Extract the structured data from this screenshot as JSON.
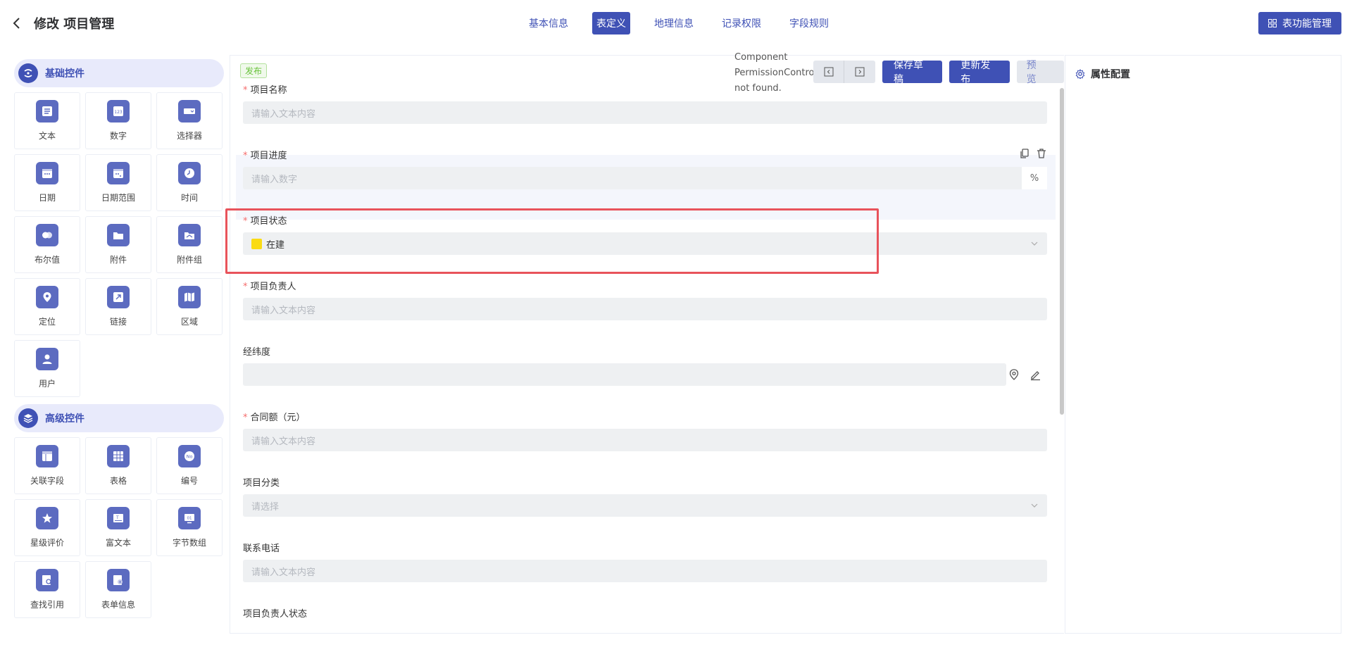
{
  "header": {
    "title": "修改 项目管理",
    "tabs": [
      "基本信息",
      "表定义",
      "地理信息",
      "记录权限",
      "字段规则"
    ],
    "active_tab": "表定义",
    "func_button": "表功能管理"
  },
  "sidebar": {
    "basic_group": "基础控件",
    "basic_items": [
      "文本",
      "数字",
      "选择器",
      "日期",
      "日期范围",
      "时间",
      "布尔值",
      "附件",
      "附件组",
      "定位",
      "链接",
      "区域",
      "用户"
    ],
    "advanced_group": "高级控件",
    "advanced_items": [
      "关联字段",
      "表格",
      "编号",
      "星级评价",
      "富文本",
      "字节数组",
      "查找引用",
      "表单信息"
    ]
  },
  "form": {
    "publish_tag": "发布",
    "error_message": "Component PermissionControl not found.",
    "save_draft": "保存草稿",
    "update_publish": "更新发布",
    "preview": "预 览",
    "fields": {
      "name": {
        "label": "项目名称",
        "placeholder": "请输入文本内容"
      },
      "progress": {
        "label": "项目进度",
        "placeholder": "请输入数字",
        "suffix": "%"
      },
      "status": {
        "label": "项目状态",
        "value": "在建",
        "color": "#fadb14"
      },
      "owner": {
        "label": "项目负责人",
        "placeholder": "请输入文本内容"
      },
      "coords": {
        "label": "经纬度"
      },
      "contract": {
        "label": "合同额（元）",
        "placeholder": "请输入文本内容"
      },
      "category": {
        "label": "项目分类",
        "placeholder": "请选择"
      },
      "phone": {
        "label": "联系电话",
        "placeholder": "请输入文本内容"
      },
      "owner_status": {
        "label": "项目负责人状态"
      }
    }
  },
  "properties": {
    "title": "属性配置"
  },
  "colors": {
    "primary": "#3f51b5",
    "required": "#f56c6c",
    "selection_border": "#e8535b"
  }
}
